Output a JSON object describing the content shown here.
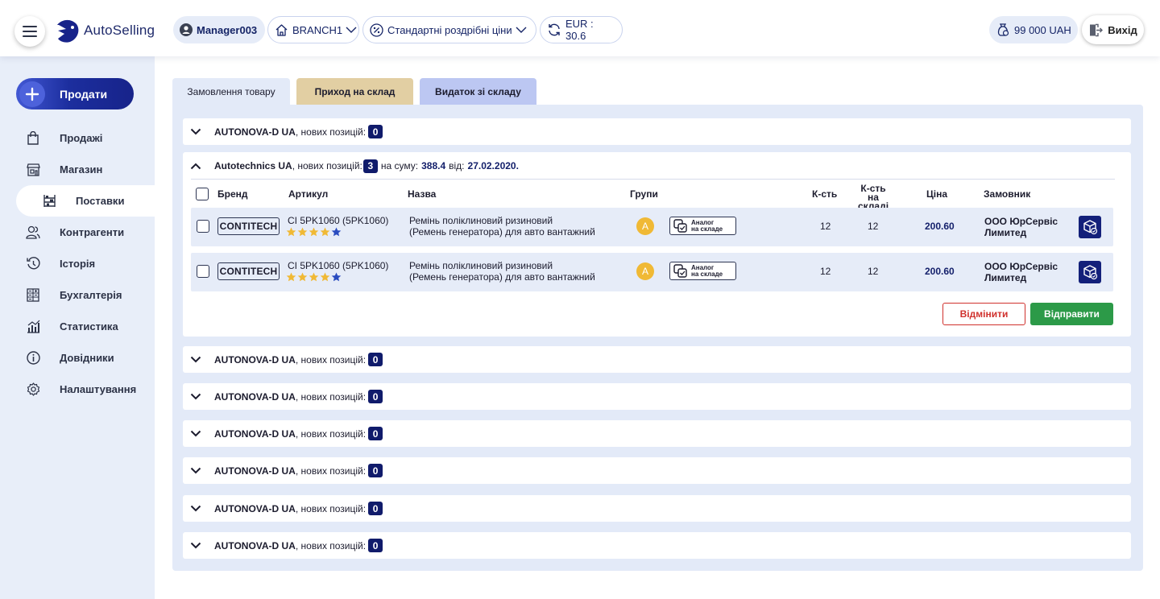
{
  "header": {
    "app_name": "AutoSelling",
    "user": "Manager003",
    "branch": "BRANCH1",
    "price_type": "Стандартні роздрібні ціни",
    "rate": "EUR : 30.6",
    "balance": "99 000 UAH",
    "exit_label": "Вихід"
  },
  "sidebar": {
    "sell_label": "Продати",
    "items": [
      {
        "label": "Продажі",
        "icon": "shopping-bag-icon"
      },
      {
        "label": "Магазин",
        "icon": "store-icon"
      },
      {
        "label": "Поставки",
        "icon": "shelves-icon",
        "active": true
      },
      {
        "label": "Контрагенти",
        "icon": "users-icon"
      },
      {
        "label": "Історія",
        "icon": "history-icon"
      },
      {
        "label": "Бухгалтерія",
        "icon": "calculator-icon"
      },
      {
        "label": "Статистика",
        "icon": "stats-icon"
      },
      {
        "label": "Довідники",
        "icon": "info-icon"
      },
      {
        "label": "Налаштування",
        "icon": "gear-icon"
      }
    ]
  },
  "tabs": [
    {
      "label": "Замовлення товару",
      "active": true
    },
    {
      "label": "Приход на склад"
    },
    {
      "label": "Видаток зі складу"
    }
  ],
  "groups": [
    {
      "supplier": "AUTONOVA-D UA",
      "text": ", нових позицій:",
      "count": "0"
    },
    {
      "supplier": "AUTONOVA-D UA",
      "text": ", нових позицій:",
      "count": "0"
    },
    {
      "supplier": "AUTONOVA-D UA",
      "text": ", нових позицій:",
      "count": "0"
    },
    {
      "supplier": "AUTONOVA-D UA",
      "text": ", нових позицій:",
      "count": "0"
    },
    {
      "supplier": "AUTONOVA-D UA",
      "text": ", нових позицій:",
      "count": "0"
    },
    {
      "supplier": "AUTONOVA-D UA",
      "text": ", нових позицій:",
      "count": "0"
    },
    {
      "supplier": "AUTONOVA-D UA",
      "text": ", нових позицій:",
      "count": "0"
    }
  ],
  "expanded": {
    "supplier": "Autotechnics UA",
    "text": ", нових позицій:",
    "count": "3",
    "sum_label": "на суму:",
    "sum": "388.4",
    "from_label": "від:",
    "date": "27.02.2020.",
    "columns": {
      "brand": "Бренд",
      "article": "Артикул",
      "name": "Назва",
      "groups": "Групи",
      "qty": "К-сть",
      "stock_line1": "К-сть",
      "stock_line2": "на складі",
      "price": "Ціна",
      "customer": "Замовник"
    },
    "rows": [
      {
        "brand": "CONTITECH",
        "article": "CI 5PK1060 (5PK1060)",
        "rating": 4,
        "name_line1": "Ремінь поліклиновий ризиновий",
        "name_line2": "(Ремень генератора) для авто вантажний",
        "group": "A",
        "analog_line1": "Аналог",
        "analog_line2": "на складе",
        "qty": "12",
        "stock": "12",
        "price": "200.60",
        "customer_line1": "ООО ЮрСервіс",
        "customer_line2": "Лимитед"
      },
      {
        "brand": "CONTITECH",
        "article": "CI 5PK1060 (5PK1060)",
        "rating": 4,
        "name_line1": "Ремінь поліклиновий ризиновий",
        "name_line2": "(Ремень генератора) для авто вантажний",
        "group": "A",
        "analog_line1": "Аналог",
        "analog_line2": "на складе",
        "qty": "12",
        "stock": "12",
        "price": "200.60",
        "customer_line1": "ООО ЮрСервіс",
        "customer_line2": "Лимитед"
      }
    ],
    "cancel_label": "Відмінити",
    "send_label": "Відправити"
  },
  "colors": {
    "accent": "#14206b",
    "sidebar_bg": "#e8eef9",
    "tab_income": "#e2cfa3",
    "tab_outcome": "#bcc7f2",
    "send": "#2c9a48",
    "cancel": "#d0312d",
    "star": "#f0b935"
  }
}
